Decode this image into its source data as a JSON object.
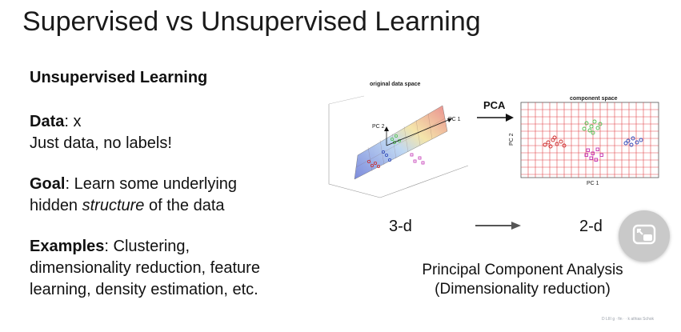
{
  "slide": {
    "title": "Supervised vs Unsupervised Learning",
    "left": {
      "heading": "Unsupervised Learning",
      "data_label": "Data",
      "data_value": ": x",
      "data_desc": "Just data, no labels!",
      "goal_label": "Goal",
      "goal_text_1": ": Learn some underlying",
      "goal_text_2a": "hidden ",
      "goal_text_2_em": "structure",
      "goal_text_2b": " of the data",
      "examples_label": "Examples",
      "examples_text_1": ": Clustering,",
      "examples_text_2": "dimensionality reduction, feature",
      "examples_text_3": "learning, density estimation, etc."
    },
    "figure": {
      "left_title": "original data space",
      "right_title": "component space",
      "pc1_label": "PC 1",
      "pc2_label": "PC 2",
      "pca_label": "PCA",
      "left_dim": "3-d",
      "right_dim": "2-d"
    },
    "caption_line1": "Principal Component Analysis",
    "caption_line2": "(Dimensionality reduction)",
    "watermark": "D LIII g ∙ fin ∙ ∙ k athias Schok"
  },
  "colors": {
    "grid_red": "#e2474b",
    "plane_blue": "#6f7fd8",
    "plane_red": "#e98484",
    "cluster_red": "#cc2a2a",
    "cluster_green": "#4fc24f",
    "cluster_magenta": "#c22fb3",
    "cluster_blue": "#2b45b8",
    "pip_button_bg": "#c9c9c9"
  },
  "icons": {
    "pip": "picture-in-picture-icon"
  }
}
